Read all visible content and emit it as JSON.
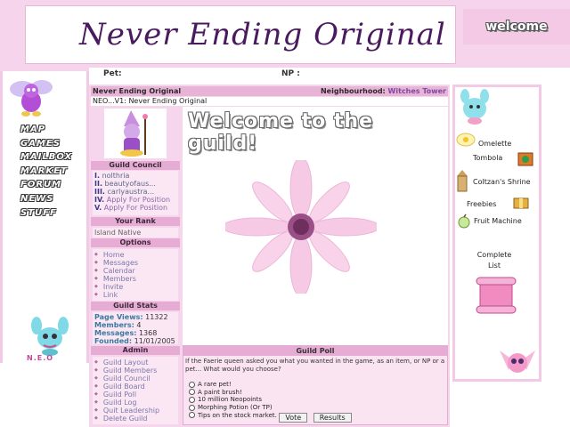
{
  "header": {
    "logo_text": "Never Ending Original",
    "welcome_badge": "welcome",
    "pet_label": "Pet:",
    "np_label": "NP :"
  },
  "left_nav": {
    "items": [
      "MAP",
      "GAMES",
      "MAILBOX",
      "MARKET",
      "FORUM",
      "NEWS",
      "STUFF"
    ],
    "footer_logo": "N.E.O"
  },
  "guild": {
    "name": "Never Ending Original",
    "neighbourhood_label": "Neighbourhood:",
    "neighbourhood_value": "Witches Tower",
    "breadcrumb": "NEO...V1: Never Ending Original",
    "welcome_heading": "Welcome to the guild!",
    "council": {
      "title": "Guild Council",
      "members": [
        {
          "num": "I.",
          "name": "nolthria"
        },
        {
          "num": "II.",
          "name": "beautyofaus..."
        },
        {
          "num": "III.",
          "name": "carlyaustra..."
        },
        {
          "num": "IV.",
          "name": "Apply For Position"
        },
        {
          "num": "V.",
          "name": "Apply For Position"
        }
      ]
    },
    "rank": {
      "title": "Your Rank",
      "value": "Island Native"
    },
    "options": {
      "title": "Options",
      "items": [
        "Home",
        "Messages",
        "Calendar",
        "Members",
        "Invite",
        "Link"
      ]
    },
    "stats": {
      "title": "Guild Stats",
      "page_views_label": "Page Views:",
      "page_views": "11322",
      "members_label": "Members:",
      "members": "4",
      "messages_label": "Messages:",
      "messages": "1368",
      "founded_label": "Founded:",
      "founded": "11/01/2005"
    },
    "admin": {
      "title": "Admin",
      "items": [
        "Guild Layout",
        "Guild Members",
        "Guild Council",
        "Guild Board",
        "Guild Poll",
        "Guild Log",
        "Quit Leadership",
        "Delete Guild"
      ]
    },
    "poll": {
      "title": "Guild Poll",
      "question": "If the Faerie queen asked you what you wanted in the game, as an item, or NP or a pet... What would you choose?",
      "options": [
        "A rare pet!",
        "A paint brush!",
        "10 million Neopoints",
        "Morphing Potion (Or TP)",
        "Tips on the stock market."
      ],
      "vote_button": "Vote",
      "results_button": "Results"
    }
  },
  "right_sidebar": {
    "links": [
      "Omelette",
      "Tombola",
      "Coltzan's Shrine",
      "Freebies",
      "Fruit Machine"
    ],
    "complete_list_line1": "Complete",
    "complete_list_line2": "List"
  },
  "colors": {
    "pink_band": "#f6d4ec",
    "section_head": "#e7acd4",
    "title_purple": "#4a1a5e"
  }
}
